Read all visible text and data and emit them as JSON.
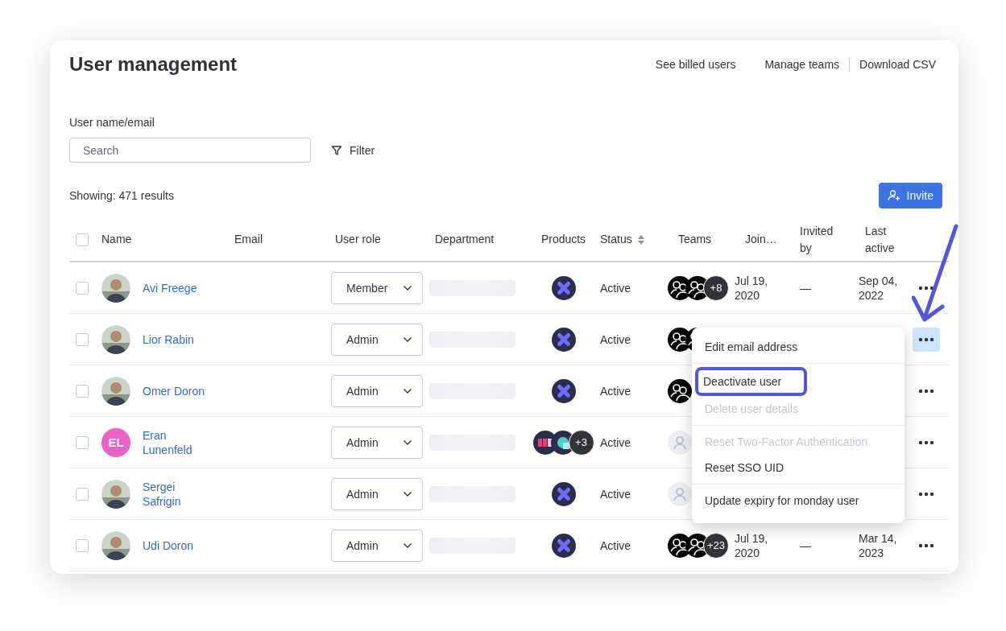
{
  "title": "User management",
  "header_link_groups": [
    [
      {
        "label": "See billed users"
      },
      {
        "label": "Manage teams"
      }
    ],
    [
      {
        "label": "Download CSV"
      }
    ]
  ],
  "search": {
    "label": "User name/email",
    "placeholder": "Search"
  },
  "filter": {
    "label": "Filter"
  },
  "results": "Showing: 471 results",
  "invite": {
    "label": "Invite"
  },
  "select_all": {
    "checked": false
  },
  "columns": [
    {
      "label": "Name"
    },
    {
      "label": "Email"
    },
    {
      "label": "User role"
    },
    {
      "label": "Department"
    },
    {
      "label": "Products"
    },
    {
      "label": "Status",
      "sortable": true
    },
    {
      "label": "Teams"
    },
    {
      "label": "Join…"
    },
    {
      "label": "Invited by"
    },
    {
      "label": "Last active"
    }
  ],
  "rows": [
    {
      "checked": false,
      "name": "Avi Freege",
      "role": "Member",
      "products": {
        "icons": [
          {
            "kind": "x"
          }
        ]
      },
      "status": "Active",
      "teams": {
        "icons": [
          {
            "kind": "team"
          },
          {
            "kind": "team"
          }
        ],
        "extra": "+8"
      },
      "joined": "Jul 19, 2020",
      "invited_by": "—",
      "last_active": "Sep 04, 2022",
      "menu_open": false
    },
    {
      "checked": false,
      "name": "Lior Rabin",
      "role": "Admin",
      "products": {
        "icons": [
          {
            "kind": "x"
          }
        ]
      },
      "status": "Active",
      "teams": {
        "icons": [
          {
            "kind": "team"
          },
          {
            "kind": "team"
          }
        ]
      },
      "menu_open": true
    },
    {
      "checked": false,
      "name": "Omer Doron",
      "role": "Admin",
      "products": {
        "icons": [
          {
            "kind": "x"
          }
        ]
      },
      "status": "Active",
      "teams": {
        "icons": [
          {
            "kind": "team"
          }
        ]
      },
      "menu_open": false
    },
    {
      "checked": false,
      "avatar": {
        "kind": "initials",
        "initials": "EL",
        "color": "#e863c4"
      },
      "name": "Eran Lunenfeld",
      "role": "Admin",
      "products": {
        "icons": [
          {
            "kind": "m"
          },
          {
            "kind": "q"
          }
        ],
        "extra": "+3"
      },
      "status": "Active",
      "teams": {
        "icons": [
          {
            "kind": "person"
          }
        ]
      },
      "menu_open": false
    },
    {
      "checked": false,
      "name": "Sergei Safrigin",
      "role": "Admin",
      "products": {
        "icons": [
          {
            "kind": "x"
          }
        ]
      },
      "status": "Active",
      "teams": {
        "icons": [
          {
            "kind": "person"
          }
        ]
      },
      "menu_open": false
    },
    {
      "checked": false,
      "name": "Udi Doron",
      "role": "Admin",
      "products": {
        "icons": [
          {
            "kind": "x"
          }
        ]
      },
      "status": "Active",
      "teams": {
        "icons": [
          {
            "kind": "team"
          },
          {
            "kind": "team"
          }
        ],
        "extra": "+23"
      },
      "joined": "Jul 19, 2020",
      "invited_by": "—",
      "last_active": "Mar 14, 2023",
      "menu_open": false
    }
  ],
  "menu": {
    "groups": [
      [
        {
          "label": "Edit email address",
          "disabled": false,
          "outlined": false
        }
      ],
      [
        {
          "label": "Deactivate user",
          "disabled": false,
          "outlined": true
        },
        {
          "label": "Delete user details",
          "disabled": true,
          "outlined": false
        }
      ],
      [
        {
          "label": "Reset Two-Factor Authentication",
          "disabled": true,
          "outlined": false
        },
        {
          "label": "Reset SSO UID",
          "disabled": false,
          "outlined": false
        }
      ],
      [
        {
          "label": "Update expiry for monday user",
          "disabled": false,
          "outlined": false
        }
      ]
    ]
  }
}
